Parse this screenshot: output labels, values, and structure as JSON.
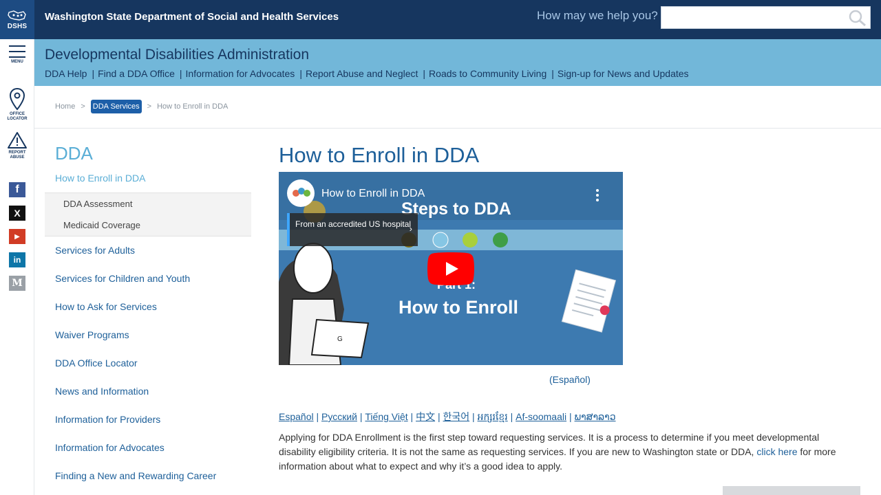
{
  "header": {
    "logo_text": "DSHS",
    "agency_name": "Washington State Department of Social and Health Services",
    "help_prompt": "How may we help you?",
    "search_placeholder": ""
  },
  "rail": {
    "menu_label": "MENU",
    "office_locator_label_1": "OFFICE",
    "office_locator_label_2": "LOCATOR",
    "report_abuse_label_1": "REPORT",
    "report_abuse_label_2": "ABUSE",
    "social": [
      {
        "name": "facebook-icon",
        "glyph": "f",
        "color": "#3b5998"
      },
      {
        "name": "x-twitter-icon",
        "glyph": "X",
        "color": "#111111"
      },
      {
        "name": "youtube-icon",
        "glyph": "▶",
        "color": "#d13c25"
      },
      {
        "name": "linkedin-icon",
        "glyph": "in",
        "color": "#0e76a8"
      },
      {
        "name": "medium-icon",
        "glyph": "M",
        "color": "#9aa0a6"
      }
    ]
  },
  "subheader": {
    "title": "Developmental Disabilities Administration",
    "nav": [
      "DDA Help",
      "Find a DDA Office",
      "Information for Advocates",
      "Report Abuse and Neglect",
      "Roads to Community Living",
      "Sign-up for News and Updates"
    ]
  },
  "breadcrumb": {
    "home": "Home",
    "section": "DDA Services",
    "current": "How to Enroll in DDA",
    "separator": ">"
  },
  "sidenav": {
    "title": "DDA",
    "current": "How to Enroll in DDA",
    "subitems": [
      "DDA Assessment",
      "Medicaid Coverage"
    ],
    "links": [
      "Services for Adults",
      "Services for Children and Youth",
      "How to Ask for Services",
      "Waiver Programs",
      "DDA Office Locator",
      "News and Information",
      "Information for Providers",
      "Information for Advocates",
      "Finding a New and Rewarding Career"
    ]
  },
  "main": {
    "title": "How to Enroll in DDA",
    "video": {
      "title": "How to Enroll in DDA",
      "info_chip": "From an accredited US hospital",
      "steps_heading": "Steps to DDA",
      "part_label": "Part 1:",
      "enroll_label": "How to Enroll",
      "laptop_glyph": "G"
    },
    "espanol_link": "(Español)",
    "languages": [
      "Español",
      "Русский",
      "Tiếng Việt",
      "中文",
      "한국어",
      " អក្សរខ្មែរ",
      "Af-soomaali",
      "ພາສາລາວ"
    ],
    "intro_text": "Applying for DDA Enrollment is the first step toward requesting services. It is a process to determine if you meet developmental disability eligibility criteria. It is not the same as requesting services. If you are new to Washington state or DDA, ",
    "intro_link": "click here",
    "intro_text_after": " for more information about what to expect and why it’s a good idea to apply."
  },
  "colors": {
    "header_bg": "#16365f",
    "subheader_bg": "#72b7d9",
    "link": "#1d5f99",
    "accent": "#5aaed6"
  }
}
